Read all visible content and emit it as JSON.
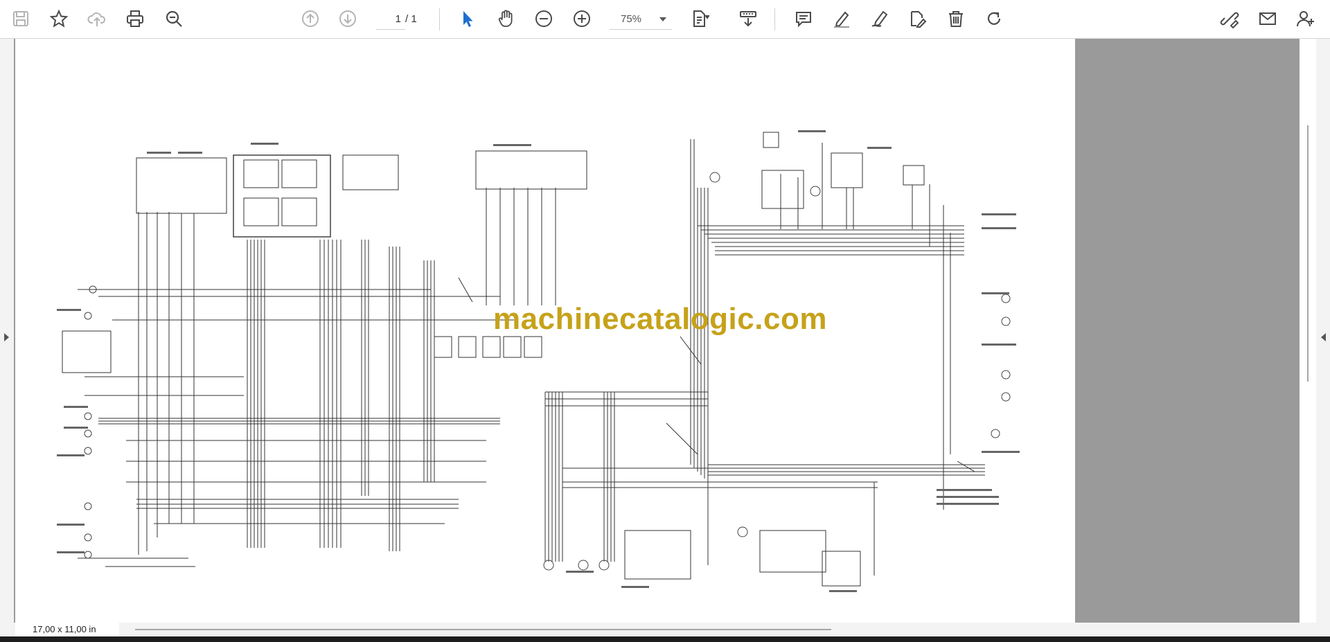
{
  "toolbar": {
    "current_page": "1",
    "total_pages": "/ 1",
    "zoom": "75%",
    "buttons": [
      {
        "name": "save-icon",
        "label": "Save",
        "disabled": true
      },
      {
        "name": "bookmark-star-icon",
        "label": "Bookmark",
        "disabled": false
      },
      {
        "name": "cloud-upload-icon",
        "label": "Upload",
        "disabled": true
      },
      {
        "name": "print-icon",
        "label": "Print",
        "disabled": false
      },
      {
        "name": "search-icon",
        "label": "Find",
        "disabled": false
      },
      {
        "name": "previous-page-icon",
        "label": "Previous page",
        "disabled": true
      },
      {
        "name": "next-page-icon",
        "label": "Next page",
        "disabled": true
      },
      {
        "name": "select-cursor-icon",
        "label": "Select",
        "disabled": false
      },
      {
        "name": "hand-tool-icon",
        "label": "Hand",
        "disabled": false
      },
      {
        "name": "zoom-out-icon",
        "label": "Zoom out",
        "disabled": false
      },
      {
        "name": "zoom-in-icon",
        "label": "Zoom in",
        "disabled": false
      },
      {
        "name": "page-fit-icon",
        "label": "Fit",
        "disabled": false
      },
      {
        "name": "scroll-mode-icon",
        "label": "Scroll mode",
        "disabled": false
      },
      {
        "name": "comment-icon",
        "label": "Comment",
        "disabled": false
      },
      {
        "name": "highlight-pen-icon",
        "label": "Highlight",
        "disabled": false
      },
      {
        "name": "draw-pen-icon",
        "label": "Draw",
        "disabled": false
      },
      {
        "name": "stamp-edit-icon",
        "label": "Edit",
        "disabled": false
      },
      {
        "name": "delete-icon",
        "label": "Delete",
        "disabled": false
      },
      {
        "name": "redo-icon",
        "label": "Redo",
        "disabled": false
      },
      {
        "name": "link-edit-icon",
        "label": "Link",
        "disabled": false
      },
      {
        "name": "email-icon",
        "label": "Email",
        "disabled": false
      },
      {
        "name": "add-user-icon",
        "label": "Share",
        "disabled": false
      }
    ]
  },
  "document": {
    "watermark": "machinecatalogic.com"
  },
  "statusbar": {
    "page_size": "17,00 x 11,00 in"
  },
  "colors": {
    "accent": "#1f6fd1",
    "icon": "#5a5a5a",
    "watermark": "#c6a21a",
    "gutter": "#9a9a9a"
  }
}
